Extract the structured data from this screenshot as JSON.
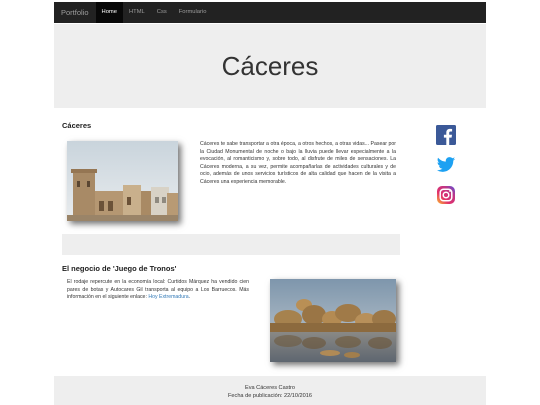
{
  "navbar": {
    "brand": "Portfolio",
    "items": [
      {
        "label": "Home",
        "active": true
      },
      {
        "label": "HTML",
        "active": false
      },
      {
        "label": "Css",
        "active": false
      },
      {
        "label": "Formulario",
        "active": false
      }
    ]
  },
  "jumbotron": {
    "title": "Cáceres"
  },
  "section1": {
    "title": "Cáceres",
    "text": "Cáceres te sabe transportar a otra época, a otros hechos, a otras vidas... Pasear por la Ciudad Monumental de noche o bajo la lluvia puede llevar especialmente a la evocación, al romanticismo y, sobre todo, al disfrute de miles de sensaciones. La Cáceres moderna, a su vez, permite acompañarlas de actividades culturales y de ocio, además de unos servicios turísticos de alta calidad que hacen de la visita a Cáceres una experiencia memorable."
  },
  "section2": {
    "title": "El negocio de 'Juego de Tronos'",
    "text": "El rodaje repercute en la economía local: Curtidos Márquez ha vendido cien pares de botas y Autocares Gil transporta al equipo a Los Barruecos. Más información en el siguiente enlace: ",
    "link_text": "Hoy Extremadura",
    "after_link": "."
  },
  "social": [
    "facebook-icon",
    "twitter-icon",
    "instagram-icon"
  ],
  "colors": {
    "navbar": "#222222",
    "jumbotron": "#eeeeee",
    "link": "#337ab7",
    "facebook": "#3b5998",
    "twitter": "#1da1f2"
  },
  "footer": {
    "author": "Eva Cáceres Castro",
    "date": "Fecha de publicación: 22/10/2016"
  }
}
